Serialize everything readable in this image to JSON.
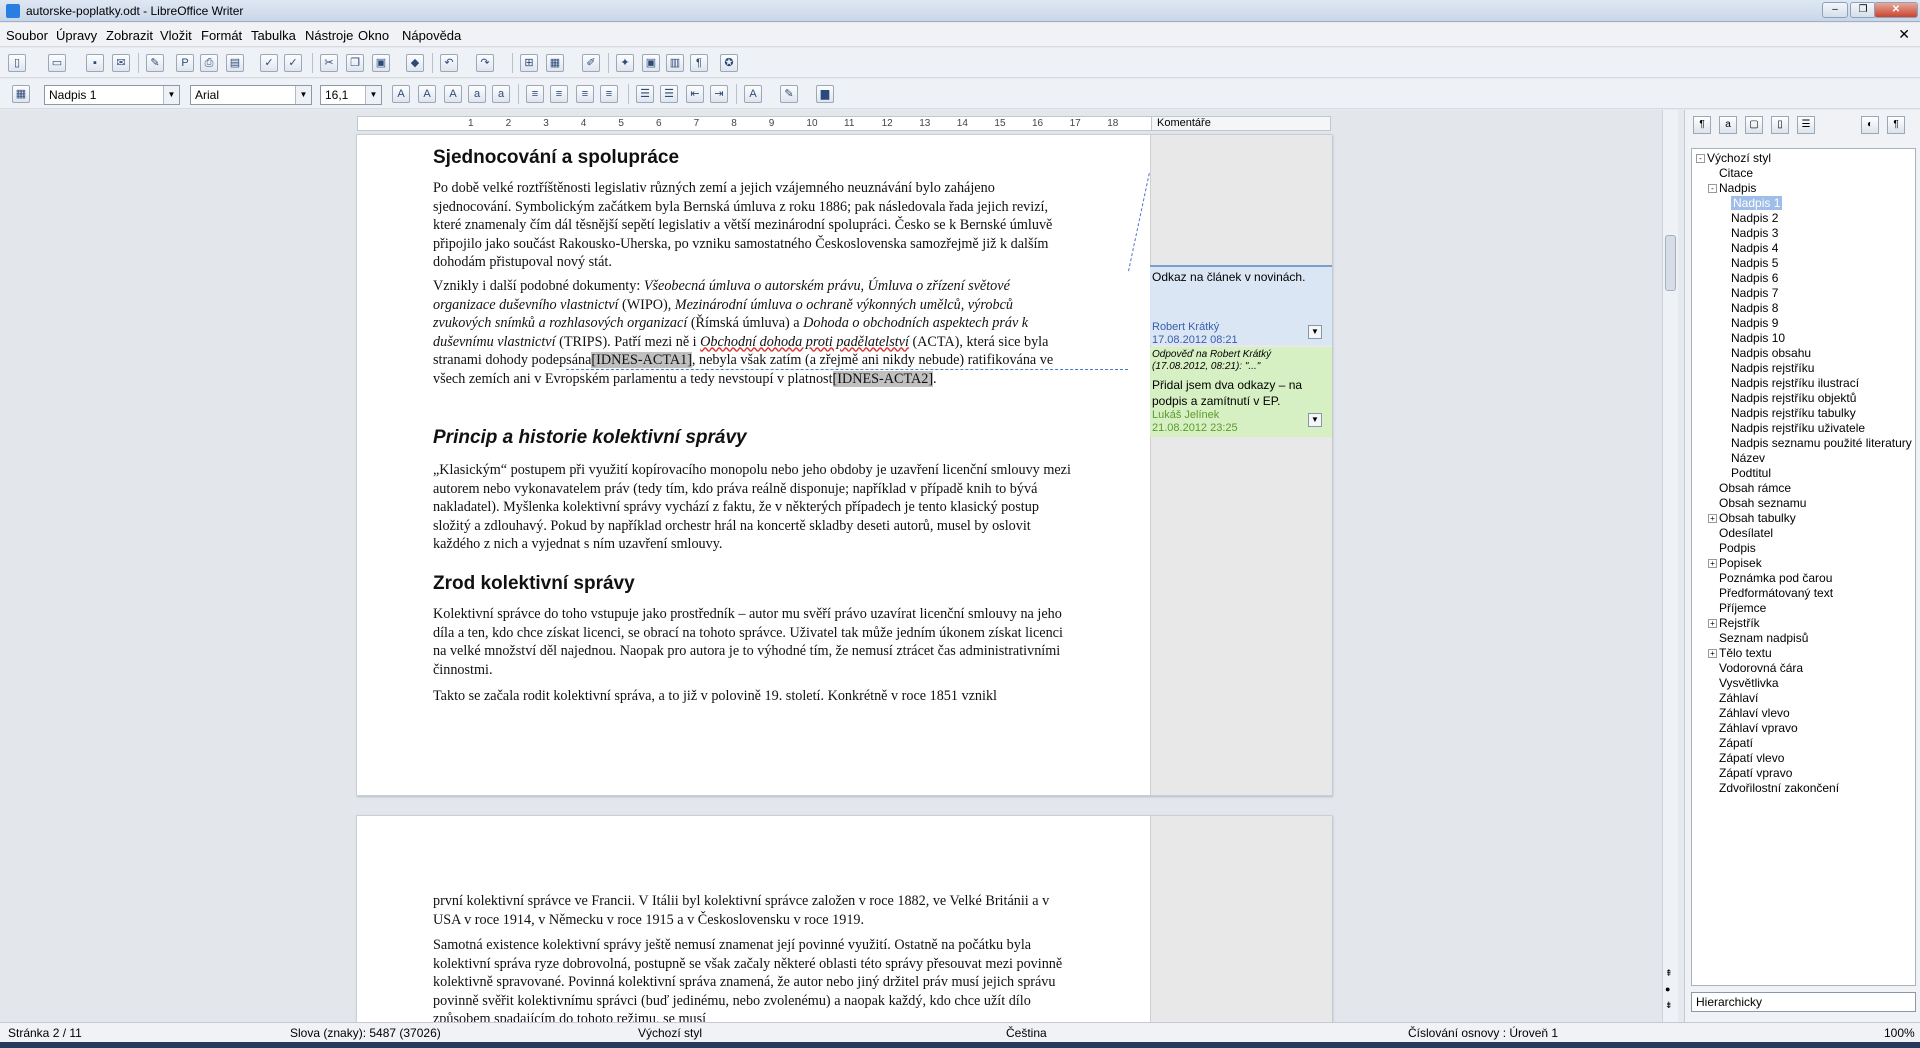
{
  "window": {
    "title": "autorske-poplatky.odt - LibreOffice Writer"
  },
  "menu": [
    "Soubor",
    "Úpravy",
    "Zobrazit",
    "Vložit",
    "Formát",
    "Tabulka",
    "Nástroje",
    "Okno",
    "Nápověda"
  ],
  "format_bar": {
    "style": "Nadpis 1",
    "font": "Arial",
    "size": "16,1"
  },
  "ruler": {
    "ticks": [
      "1",
      "2",
      "3",
      "4",
      "5",
      "6",
      "7",
      "8",
      "9",
      "10",
      "11",
      "12",
      "13",
      "14",
      "15",
      "16",
      "17",
      "18"
    ],
    "comments_label": "Komentáře"
  },
  "page1": {
    "h1": "Sjednocování a spolupráce",
    "p1": "Po době velké roztříštěnosti legislativ různých zemí a jejich vzájemného neuznávání bylo zahájeno sjednocování. Symbolickým začátkem byla Bernská úmluva z roku 1886; pak následovala řada jejich revizí, které znamenaly čím dál těsnější sepětí legislativ a větší mezinárodní spolupráci. Česko se k Bernské úmluvě připojilo jako součást Rakousko-Uherska, po vzniku samostatného Československa samozřejmě již k dalším dohodám přistupoval nový stát.",
    "p2_a": "Vznikly i další podobné dokumenty: ",
    "p2_b": "Všeobecná úmluva o autorském právu, Úmluva o zřízení světové organizace duševního vlastnictví",
    "p2_c": " (WIPO), ",
    "p2_d": "Mezinárodní úmluva o ochraně výkonných umělců, výrobců zvukových snímků a rozhlasových organizací",
    "p2_e": " (Římská úmluva) a ",
    "p2_f": "Dohoda o obchodních aspektech práv k duševnímu vlastnictví",
    "p2_g": " (TRIPS). Patří mezi ně i ",
    "p2_h": "Obchodní dohoda proti padělatelství",
    "p2_i": " (ACTA), která sice byla stranami dohody podepsána",
    "p2_field1": "[IDNES-ACTA1]",
    "p2_j": ", nebyla však zatím (a zřejmě ani nikdy nebude) ratifikována ve všech zemích ani v Evropském parlamentu a tedy nevstoupí v platnost",
    "p2_field2": "[IDNES-ACTA2]",
    "p2_k": ".",
    "h2": "Princip a historie kolektivní správy",
    "p3": "„Klasickým“ postupem při využití kopírovacího monopolu nebo jeho obdoby je uzavření licenční smlouvy mezi autorem nebo vykonavatelem práv (tedy tím, kdo práva reálně disponuje; například v případě knih to bývá nakladatel). Myšlenka kolektivní správy vychází z faktu, že v některých případech je tento klasický postup složitý a zdlouhavý. Pokud by například orchestr hrál na koncertě skladby deseti autorů, musel by oslovit každého z nich a vyjednat s ním uzavření smlouvy.",
    "h3": "Zrod kolektivní správy",
    "p4": "Kolektivní správce do toho vstupuje jako prostředník – autor mu svěří právo uzavírat licenční smlouvy na jeho díla a ten, kdo chce získat licenci, se obrací na tohoto správce. Uživatel tak může jedním úkonem získat licenci na velké množství děl najednou. Naopak pro autora je to výhodné tím, že nemusí ztrácet čas administrativními činnostmi.",
    "p5": "Takto se začala rodit kolektivní správa, a to již v polovině 19. století. Konkrétně v roce 1851 vznikl"
  },
  "page2": {
    "p1": "první kolektivní správce ve Francii. V Itálii byl kolektivní správce založen v roce 1882, ve Velké Británii a v USA v roce 1914, v Německu v roce 1915 a v Československu v roce 1919.",
    "p2": "Samotná existence kolektivní správy ještě nemusí znamenat její povinné využití. Ostatně na počátku byla kolektivní správa ryze dobrovolná, postupně se však začaly některé oblasti této správy přesouvat mezi povinně kolektivně spravované. Povinná kolektivní správa znamená, že autor nebo jiný držitel práv musí jejich správu povinně svěřit kolektivnímu správci (buď jedinému, nebo zvolenému) a naopak každý, kdo chce užít dílo způsobem spadajícím do tohoto režimu, se musí"
  },
  "comments": [
    {
      "text": "Odkaz na článek v novinách.",
      "author": "Robert Krátký",
      "date": "17.08.2012 08:21"
    },
    {
      "reply_to": "Odpověď na Robert Krátký (17.08.2012, 08:21): \"...\"",
      "text": "Přidal jsem dva odkazy – na podpis a zamítnutí v EP.",
      "author": "Lukáš Jelínek",
      "date": "21.08.2012 23:25"
    }
  ],
  "styles_tree": [
    {
      "label": "Výchozí styl",
      "level": 0,
      "toggle": "-"
    },
    {
      "label": "Citace",
      "level": 1
    },
    {
      "label": "Nadpis",
      "level": 1,
      "toggle": "-"
    },
    {
      "label": "Nadpis 1",
      "level": 2,
      "selected": true
    },
    {
      "label": "Nadpis 2",
      "level": 2
    },
    {
      "label": "Nadpis 3",
      "level": 2
    },
    {
      "label": "Nadpis 4",
      "level": 2
    },
    {
      "label": "Nadpis 5",
      "level": 2
    },
    {
      "label": "Nadpis 6",
      "level": 2
    },
    {
      "label": "Nadpis 7",
      "level": 2
    },
    {
      "label": "Nadpis 8",
      "level": 2
    },
    {
      "label": "Nadpis 9",
      "level": 2
    },
    {
      "label": "Nadpis 10",
      "level": 2
    },
    {
      "label": "Nadpis obsahu",
      "level": 2
    },
    {
      "label": "Nadpis rejstříku",
      "level": 2
    },
    {
      "label": "Nadpis rejstříku ilustrací",
      "level": 2
    },
    {
      "label": "Nadpis rejstříku objektů",
      "level": 2
    },
    {
      "label": "Nadpis rejstříku tabulky",
      "level": 2
    },
    {
      "label": "Nadpis rejstříku uživatele",
      "level": 2
    },
    {
      "label": "Nadpis seznamu použité literatury",
      "level": 2
    },
    {
      "label": "Název",
      "level": 2
    },
    {
      "label": "Podtitul",
      "level": 2
    },
    {
      "label": "Obsah rámce",
      "level": 1
    },
    {
      "label": "Obsah seznamu",
      "level": 1
    },
    {
      "label": "Obsah tabulky",
      "level": 1,
      "toggle": "+"
    },
    {
      "label": "Odesílatel",
      "level": 1
    },
    {
      "label": "Podpis",
      "level": 1
    },
    {
      "label": "Popisek",
      "level": 1,
      "toggle": "+"
    },
    {
      "label": "Poznámka pod čarou",
      "level": 1
    },
    {
      "label": "Předformátovaný text",
      "level": 1
    },
    {
      "label": "Příjemce",
      "level": 1
    },
    {
      "label": "Rejstřík",
      "level": 1,
      "toggle": "+"
    },
    {
      "label": "Seznam nadpisů",
      "level": 1
    },
    {
      "label": "Tělo textu",
      "level": 1,
      "toggle": "+"
    },
    {
      "label": "Vodorovná čára",
      "level": 1
    },
    {
      "label": "Vysvětlivka",
      "level": 1
    },
    {
      "label": "Záhlaví",
      "level": 1
    },
    {
      "label": "Záhlaví vlevo",
      "level": 1
    },
    {
      "label": "Záhlaví vpravo",
      "level": 1
    },
    {
      "label": "Zápatí",
      "level": 1
    },
    {
      "label": "Zápatí vlevo",
      "level": 1
    },
    {
      "label": "Zápatí vpravo",
      "level": 1
    },
    {
      "label": "Zdvořilostní zakončení",
      "level": 1
    }
  ],
  "styles_filter": "Hierarchicky",
  "status": {
    "page": "Stránka 2 / 11",
    "words": "Slova (znaky): 5487 (37026)",
    "style": "Výchozí styl",
    "lang": "Čeština",
    "outline": "Číslování osnovy : Úroveň 1",
    "zoom": "100%"
  }
}
